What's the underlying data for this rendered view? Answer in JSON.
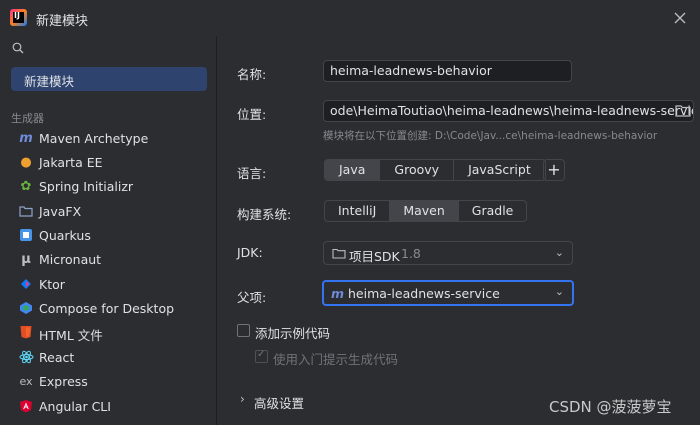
{
  "window": {
    "title": "新建模块"
  },
  "sidebar": {
    "selected": "新建模块",
    "generators_label": "生成器",
    "generators": [
      {
        "label": "Maven Archetype",
        "icon": "maven-icon"
      },
      {
        "label": "Jakarta EE",
        "icon": "jakarta-icon"
      },
      {
        "label": "Spring Initializr",
        "icon": "spring-icon"
      },
      {
        "label": "JavaFX",
        "icon": "javafx-icon"
      },
      {
        "label": "Quarkus",
        "icon": "quarkus-icon"
      },
      {
        "label": "Micronaut",
        "icon": "micronaut-icon"
      },
      {
        "label": "Ktor",
        "icon": "ktor-icon"
      },
      {
        "label": "Compose for Desktop",
        "icon": "compose-icon"
      },
      {
        "label": "HTML 文件",
        "icon": "html-icon"
      },
      {
        "label": "React",
        "icon": "react-icon"
      },
      {
        "label": "Express",
        "icon": "express-icon"
      },
      {
        "label": "Angular CLI",
        "icon": "angular-icon"
      }
    ]
  },
  "form": {
    "name_label": "名称:",
    "name_value": "heima-leadnews-behavior",
    "location_label": "位置:",
    "location_value": "ode\\HeimaToutiao\\heima-leadnews\\heima-leadnews-service",
    "location_hint": "模块将在以下位置创建: D:\\Code\\Jav...ce\\heima-leadnews-behavior",
    "language_label": "语言:",
    "languages": [
      "Java",
      "Groovy",
      "JavaScript"
    ],
    "language_selected": "Java",
    "add_label": "+",
    "build_label": "构建系统:",
    "builds": [
      "IntelliJ",
      "Maven",
      "Gradle"
    ],
    "build_selected": "Maven",
    "jdk_label": "JDK:",
    "jdk_name": "项目SDK",
    "jdk_version": "1.8",
    "parent_label": "父项:",
    "parent_value": "heima-leadnews-service",
    "sample_label": "添加示例代码",
    "onboarding_label": "使用入门提示生成代码",
    "advanced_label": "高级设置"
  },
  "watermark": "CSDN @菠菠萝宝",
  "colors": {
    "accent": "#3574f0",
    "selected_bg": "#2e436e",
    "background": "#2b2d30"
  }
}
